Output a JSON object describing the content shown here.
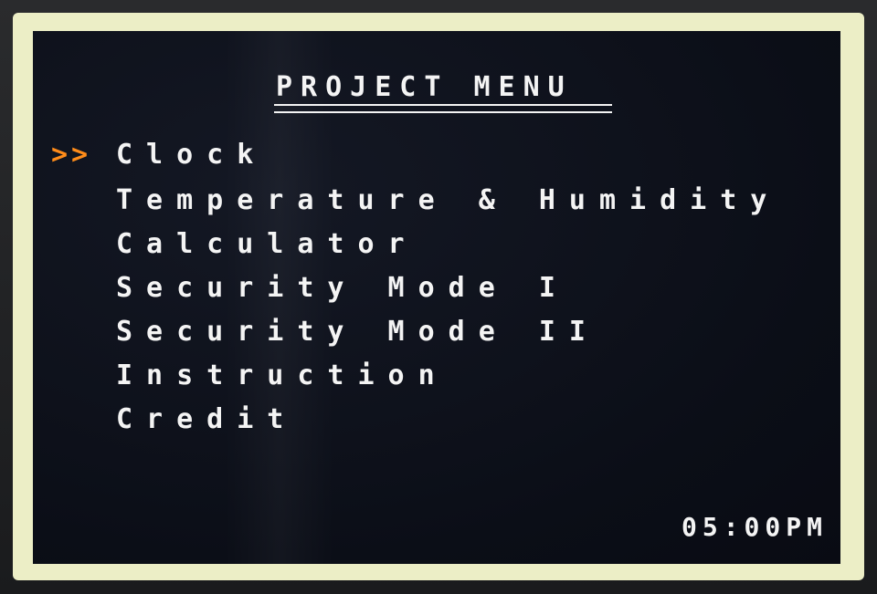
{
  "screen": {
    "title": "PROJECT MENU",
    "cursor": ">>",
    "menu_items": [
      "Clock",
      "Temperature & Humidity",
      "Calculator",
      "Security Mode I",
      "Security Mode II",
      "Instruction",
      "Credit"
    ],
    "time": "05:00PM"
  },
  "colors": {
    "background": "#0b0e17",
    "text": "#f4f4f4",
    "cursor": "#ff8c1a",
    "bezel": "#eceec6"
  }
}
